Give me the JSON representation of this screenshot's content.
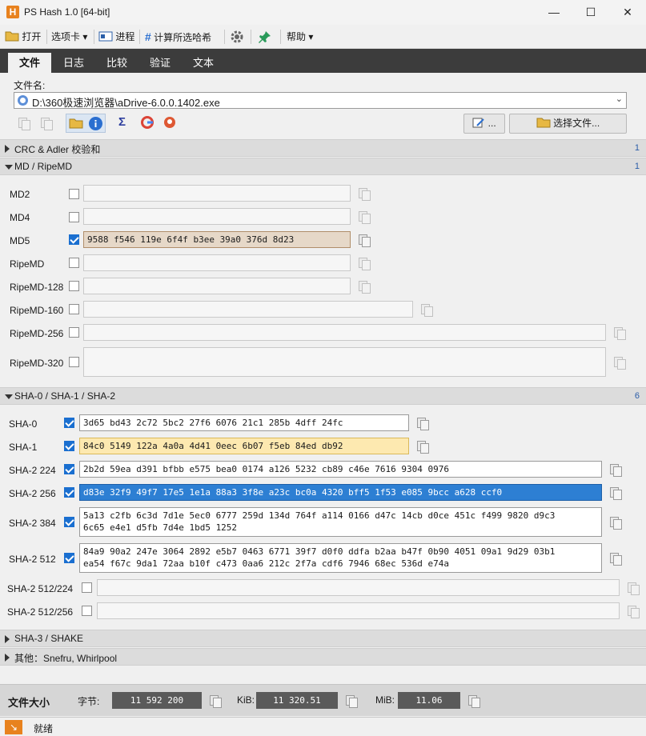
{
  "window": {
    "title": "PS Hash 1.0   [64-bit]",
    "app_icon_letter": "H",
    "minimize": "—",
    "maximize": "☐",
    "close": "✕"
  },
  "toolbar": {
    "open": "打开",
    "options": "选项卡 ▾",
    "process": "进程",
    "compute_selected": "计算所选哈希",
    "help": "帮助 ▾"
  },
  "tabs": [
    "文件",
    "日志",
    "比较",
    "验证",
    "文本"
  ],
  "file": {
    "label": "文件名:",
    "path": "D:\\360极速浏览器\\aDrive-6.0.0.1402.exe",
    "more_button": "...",
    "choose_button": "选择文件..."
  },
  "sections": {
    "crc": {
      "title": "CRC & Adler 校验和",
      "count": "1"
    },
    "md": {
      "title": "MD / RipeMD",
      "count": "1"
    },
    "sha": {
      "title": "SHA-0 / SHA-1 / SHA-2",
      "count": "6"
    },
    "sha3": {
      "title": "SHA-3 / SHAKE"
    },
    "other": {
      "title": "其他：Snefru, Whirlpool"
    }
  },
  "md_rows": [
    {
      "label": "MD2",
      "checked": false,
      "value": ""
    },
    {
      "label": "MD4",
      "checked": false,
      "value": ""
    },
    {
      "label": "MD5",
      "checked": true,
      "value": "9588 f546 119e 6f4f b3ee 39a0 376d 8d23"
    },
    {
      "label": "RipeMD",
      "checked": false,
      "value": ""
    },
    {
      "label": "RipeMD-128",
      "checked": false,
      "value": ""
    },
    {
      "label": "RipeMD-160",
      "checked": false,
      "value": ""
    },
    {
      "label": "RipeMD-256",
      "checked": false,
      "value": ""
    },
    {
      "label": "RipeMD-320",
      "checked": false,
      "value": ""
    }
  ],
  "sha_rows": [
    {
      "label": "SHA-0",
      "checked": true,
      "value": "3d65 bd43 2c72 5bc2 27f6 6076 21c1 285b 4dff 24fc"
    },
    {
      "label": "SHA-1",
      "checked": true,
      "value": "84c0 5149 122a 4a0a 4d41 0eec 6b07 f5eb 84ed db92"
    },
    {
      "label": "SHA-2 224",
      "checked": true,
      "value": "2b2d 59ea d391 bfbb e575 bea0 0174 a126 5232 cb89 c46e 7616 9304 0976"
    },
    {
      "label": "SHA-2 256",
      "checked": true,
      "value": "d83e 32f9 49f7 17e5 1e1a 88a3 3f8e a23c bc0a 4320 bff5 1f53 e085 9bcc a628 ccf0"
    },
    {
      "label": "SHA-2 384",
      "checked": true,
      "value": "5a13 c2fb 6c3d 7d1e 5ec0 6777 259d 134d 764f a114 0166 d47c 14cb d0ce 451c f499 9820 d9c3\n6c65 e4e1 d5fb 7d4e 1bd5 1252"
    },
    {
      "label": "SHA-2 512",
      "checked": true,
      "value": "84a9 90a2 247e 3064 2892 e5b7 0463 6771 39f7 d0f0 ddfa b2aa b47f 0b90 4051 09a1 9d29 03b1\nea54 f67c 9da1 72aa b10f c473 0aa6 212c 2f7a cdf6 7946 68ec 536d e74a"
    },
    {
      "label": "SHA-2 512/224",
      "checked": false,
      "value": ""
    },
    {
      "label": "SHA-2 512/256",
      "checked": false,
      "value": ""
    }
  ],
  "filesize": {
    "title": "文件大小",
    "bytes_label": "字节:",
    "bytes": "11 592 200",
    "kib_label": "KiB:",
    "kib": "11 320.51",
    "mib_label": "MiB:",
    "mib": "11.06"
  },
  "status": {
    "text": "就绪"
  },
  "colors": {
    "md5_bg": "#e6d8c8",
    "sha1_bg": "#fde9b0",
    "selected_bg": "#2d7fd3",
    "tabbar_bg": "#3c3c3c",
    "status_icon": "#e8821e"
  }
}
